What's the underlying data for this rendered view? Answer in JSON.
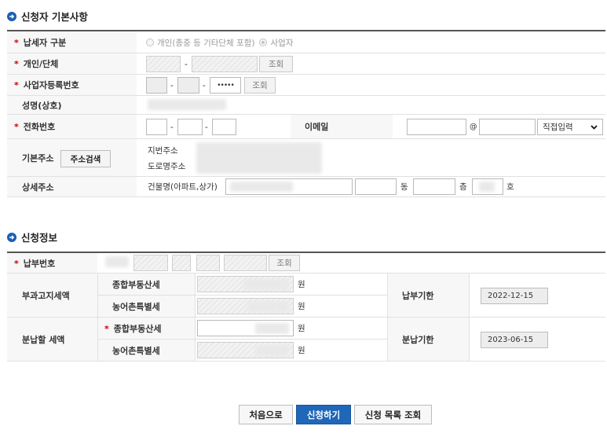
{
  "applicant": {
    "title": "신청자 기본사항",
    "taxpayer_type": {
      "label": "납세자 구분",
      "option_individual": "개인(종중 등 기타단체 포함)",
      "option_business": "사업자"
    },
    "group": {
      "label": "개인/단체",
      "dash": "-",
      "search_label": "조회"
    },
    "biz_no": {
      "label": "사업자등록번호",
      "dash1": "-",
      "dash2": "-",
      "masked_value": "•••••",
      "search_label": "조회"
    },
    "name": {
      "label": "성명(상호)"
    },
    "phone": {
      "label": "전화번호",
      "dash1": "-",
      "dash2": "-"
    },
    "email": {
      "label": "이메일",
      "at": "@",
      "domain_select": "직접입력"
    },
    "address": {
      "label": "기본주소",
      "search_button": "주소검색",
      "jibun_label": "지번주소",
      "road_label": "도로명주소"
    },
    "detail_address": {
      "label": "상세주소",
      "building_label": "건물명(아파트,상가)",
      "dong_unit": "동",
      "floor_unit": "층",
      "ho_unit": "호"
    }
  },
  "application": {
    "title": "신청정보",
    "payment_no": {
      "label": "납부번호",
      "search_label": "조회"
    },
    "notified_tax": {
      "label": "부과고지세액",
      "comprehensive_label": "종합부동산세",
      "rural_label": "농어촌특별세",
      "currency": "원",
      "due_label": "납부기한",
      "due_date": "2022-12-15"
    },
    "installment": {
      "label": "분납할 세액",
      "comprehensive_label": "종합부동산세",
      "rural_label": "농어촌특별세",
      "currency": "원",
      "due_label": "분납기한",
      "due_date": "2023-06-15"
    }
  },
  "actions": {
    "first": "처음으로",
    "apply": "신청하기",
    "list": "신청 목록 조회"
  },
  "colors": {
    "accent": "#1f67b9",
    "required": "#cc0000"
  }
}
